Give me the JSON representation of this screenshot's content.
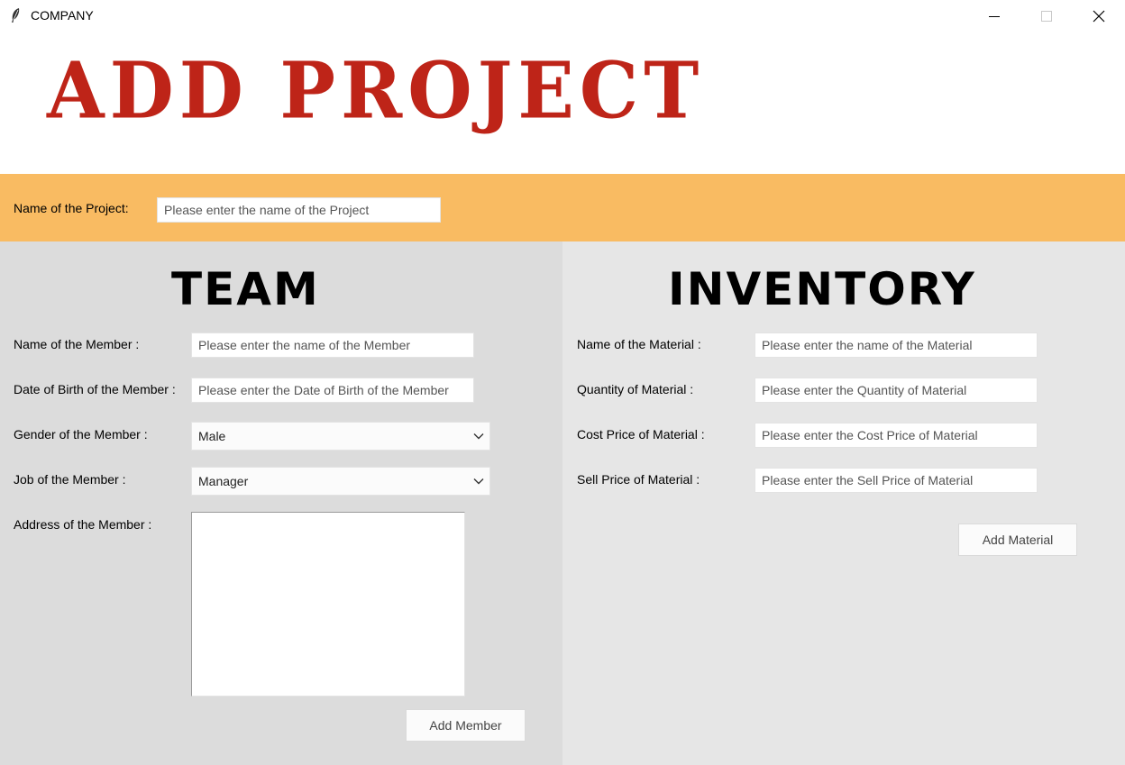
{
  "window": {
    "title": "COMPANY",
    "app_icon": "feather-icon",
    "controls": [
      "minimize-icon",
      "maximize-icon",
      "close-icon"
    ]
  },
  "header": {
    "title": "ADD PROJECT",
    "color": "#be2418"
  },
  "project": {
    "label": "Name of the Project:",
    "placeholder": "Please enter the name of the Project",
    "bar_color": "#f9bb62"
  },
  "team": {
    "title": "TEAM",
    "name_label": "Name of the Member :",
    "name_placeholder": "Please enter the name of the Member",
    "dob_label": "Date of Birth of the Member :",
    "dob_placeholder": "Please enter the Date of Birth of the Member",
    "gender_label": "Gender of the Member :",
    "gender_value": "Male",
    "job_label": "Job of the Member :",
    "job_value": "Manager",
    "address_label": "Address of the Member :",
    "add_button": "Add Member"
  },
  "inventory": {
    "title": "INVENTORY",
    "material_label": "Name of the Material :",
    "material_placeholder": "Please enter the name of the Material",
    "quantity_label": "Quantity of Material :",
    "quantity_placeholder": "Please enter the Quantity of Material",
    "cost_label": "Cost Price of Material :",
    "cost_placeholder": "Please enter the Cost Price of Material",
    "sell_label": "Sell Price of Material :",
    "sell_placeholder": "Please enter the Sell Price of Material",
    "add_button": "Add Material"
  }
}
